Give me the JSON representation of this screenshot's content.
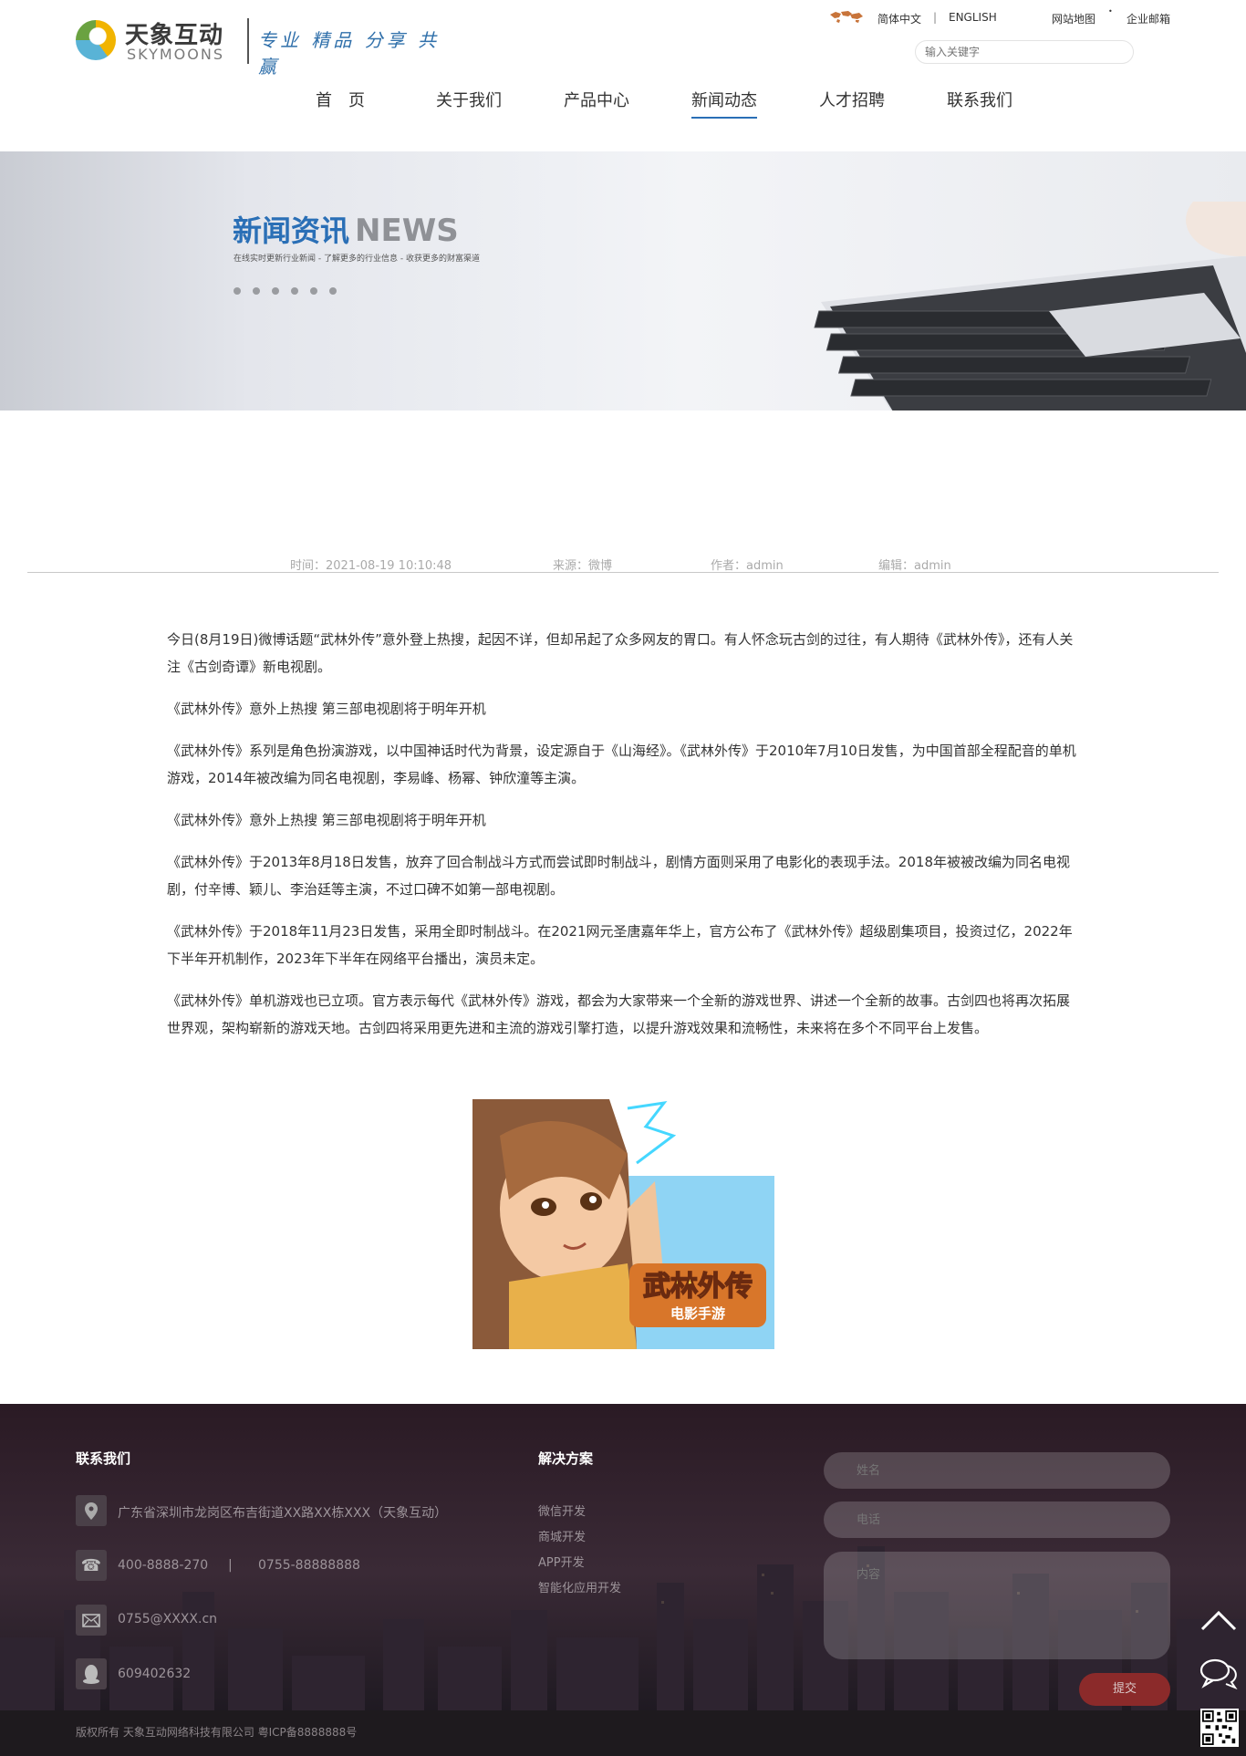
{
  "header": {
    "logo_cn": "天象互动",
    "logo_en": "SKYMOONS",
    "slogan": "专业 精品 分享 共赢",
    "lang_cn": "简体中文",
    "lang_sep": "|",
    "lang_en": "ENGLISH",
    "sitemap": "网站地图",
    "mail": "企业邮箱",
    "search_placeholder": "输入关键字",
    "nav": [
      "首　页",
      "关于我们",
      "产品中心",
      "新闻动态",
      "人才招聘",
      "联系我们"
    ],
    "nav_active": "新闻动态",
    "accent": "#2a6fb6"
  },
  "banner": {
    "title": "新闻资讯",
    "title_en": "NEWS",
    "subtitle": "在线实时更新行业新闻 - 了解更多的行业信息 - 收获更多的财富渠道"
  },
  "meta": {
    "time": "时间：2021-08-19 10:10:48",
    "source": "来源：微博",
    "author": "作者：admin",
    "editor": "编辑：admin"
  },
  "article": {
    "paragraphs": [
      "今日(8月19日)微博话题“武林外传”意外登上热搜，起因不详，但却吊起了众多网友的胃口。有人怀念玩古剑的过往，有人期待《武林外传》，还有人关注《古剑奇谭》新电视剧。",
      "《武林外传》意外上热搜 第三部电视剧将于明年开机",
      "《武林外传》系列是角色扮演游戏，以中国神话时代为背景，设定源自于《山海经》。《武林外传》于2010年7月10日发售，为中国首部全程配音的单机游戏，2014年被改编为同名电视剧，李易峰、杨幂、钟欣潼等主演。",
      "《武林外传》意外上热搜 第三部电视剧将于明年开机",
      "《武林外传》于2013年8月18日发售，放弃了回合制战斗方式而尝试即时制战斗，剧情方面则采用了电影化的表现手法。2018年被被改编为同名电视剧，付辛博、颖儿、李治廷等主演，不过口碑不如第一部电视剧。",
      "《武林外传》于2018年11月23日发售，采用全即时制战斗。在2021网元圣唐嘉年华上，官方公布了《武林外传》超级剧集项目，投资过亿，2022年下半年开机制作，2023年下半年在网络平台播出，演员未定。",
      "《武林外传》单机游戏也已立项。官方表示每代《武林外传》游戏，都会为大家带来一个全新的游戏世界、讲述一个全新的故事。古剑四也将再次拓展世界观，架构崭新的游戏天地。古剑四将采用更先进和主流的游戏引擎打造，以提升游戏效果和流畅性，未来将在多个不同平台上发售。"
    ],
    "image_title_line1": "武林外传",
    "image_title_line2": "电影手游"
  },
  "footer": {
    "contact_title": "联系我们",
    "address": "广东省深圳市龙岗区布吉街道XX路XX栋XXX（天象互动）",
    "phone1": "400-8888-270",
    "phone_sep": "|",
    "phone2": "0755-88888888",
    "email": "0755@XXXX.cn",
    "qq": "609402632",
    "solutions_title": "解决方案",
    "solutions": [
      "微信开发",
      "商城开发",
      "APP开发",
      "智能化应用开发"
    ],
    "form_name": "姓名",
    "form_phone": "电话",
    "form_content": "内容",
    "submit": "提交",
    "copyright": "版权所有 天象互动网络科技有限公司 粤ICP备8888888号"
  }
}
